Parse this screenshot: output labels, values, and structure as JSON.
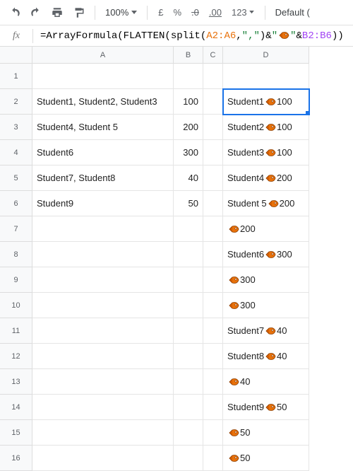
{
  "toolbar": {
    "zoom": "100%",
    "currency": "£",
    "percent": "%",
    "dec_dec": ".0",
    "dec_inc": ".00",
    "num_fmt": "123",
    "font": "Default ("
  },
  "formula": {
    "prefix": "=ArrayFormula(FLATTEN(split(",
    "range1": "A2:A6",
    "comma1": ",",
    "str1": "\",\"",
    "amp1": ")&",
    "str2": "\"",
    "str3": "\"",
    "amp2": "&",
    "range2": "B2:B6",
    "suffix": "))"
  },
  "columns": [
    "A",
    "B",
    "C",
    "D"
  ],
  "rows": [
    "1",
    "2",
    "3",
    "4",
    "5",
    "6",
    "7",
    "8",
    "9",
    "10",
    "11",
    "12",
    "13",
    "14",
    "15",
    "16"
  ],
  "cells": {
    "A": [
      "",
      "Student1, Student2, Student3",
      "Student4, Student 5",
      "Student6",
      "Student7, Student8",
      "Student9",
      "",
      "",
      "",
      "",
      "",
      "",
      "",
      "",
      "",
      ""
    ],
    "B": [
      "",
      "100",
      "200",
      "300",
      "40",
      "50",
      "",
      "",
      "",
      "",
      "",
      "",
      "",
      "",
      "",
      ""
    ],
    "D_prefix": [
      "",
      "Student1",
      "Student2",
      "Student3",
      "Student4",
      " Student 5",
      "",
      "Student6",
      "",
      "",
      "Student7",
      " Student8",
      "",
      "Student9",
      "",
      ""
    ],
    "D_suffix": [
      "",
      "100",
      "100",
      "100",
      "200",
      "200",
      "200",
      "300",
      "300",
      "300",
      "40",
      "40",
      "40",
      "50",
      "50",
      "50"
    ]
  }
}
